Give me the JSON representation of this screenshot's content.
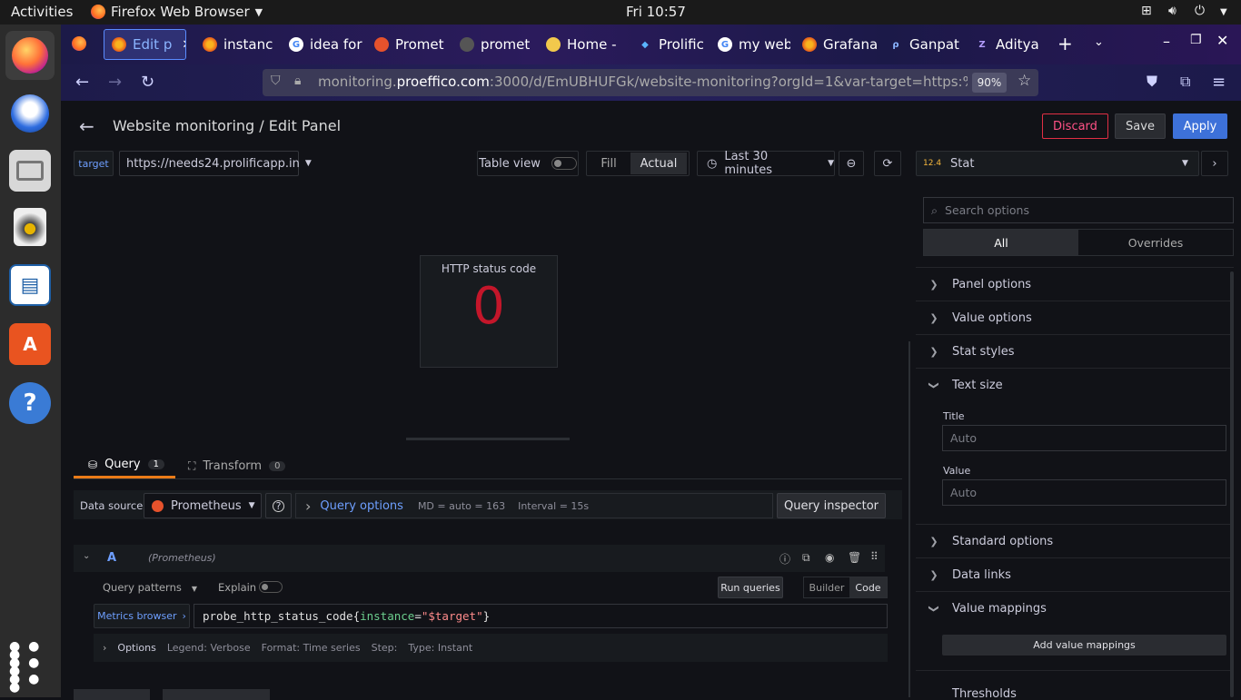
{
  "os": {
    "activities": "Activities",
    "app_menu": "Firefox Web Browser",
    "clock": "Fri 10:57"
  },
  "dock": {
    "apps": [
      "firefox",
      "thunderbird",
      "files",
      "rhythmbox",
      "writer",
      "software",
      "help"
    ]
  },
  "browser": {
    "tabs": [
      {
        "label": "Edit p",
        "icon": "grafana",
        "active": true
      },
      {
        "label": "instanc",
        "icon": "grafana"
      },
      {
        "label": "idea for",
        "icon": "google"
      },
      {
        "label": "Promet",
        "icon": "prometheus"
      },
      {
        "label": "promet",
        "icon": "github"
      },
      {
        "label": "Home -",
        "icon": "home"
      },
      {
        "label": "Prolific",
        "icon": "prolific"
      },
      {
        "label": "my web",
        "icon": "google"
      },
      {
        "label": "Grafana",
        "icon": "grafana"
      },
      {
        "label": "Ganpat",
        "icon": "ganpat"
      },
      {
        "label": "Aditya",
        "icon": "aditya"
      }
    ],
    "url_prefix": "monitoring.",
    "url_domain": "proeffico.com",
    "url_rest": ":3000/d/EmUBHUFGk/website-monitoring?orgId=1&var-target=https:%2F%",
    "zoom": "90%"
  },
  "grafana": {
    "title": "Website monitoring / Edit Panel",
    "discard": "Discard",
    "save": "Save",
    "apply": "Apply",
    "var_label": "target",
    "var_value": "https://needs24.prolificapp.in",
    "table_view": "Table view",
    "fill": "Fill",
    "actual": "Actual",
    "time_range": "Last 30 minutes",
    "viz_type": "Stat",
    "stat": {
      "title": "HTTP status code",
      "value": "0"
    },
    "tabs": {
      "query": "Query",
      "query_count": "1",
      "transform": "Transform",
      "transform_count": "0"
    },
    "datasource_label": "Data source",
    "datasource": "Prometheus",
    "query_options": "Query options",
    "md": "MD = auto = 163",
    "interval": "Interval = 15s",
    "query_inspector": "Query inspector",
    "query": {
      "ref": "A",
      "ds": "(Prometheus)",
      "patterns": "Query patterns",
      "explain": "Explain",
      "run": "Run queries",
      "builder": "Builder",
      "code": "Code",
      "metrics_browser": "Metrics browser",
      "expr_metric": "probe_http_status_code",
      "expr_label": "instance",
      "expr_value": "\"$target\"",
      "options": "Options",
      "legend": "Legend: Verbose",
      "format": "Format: Time series",
      "step": "Step:",
      "type": "Type: Instant"
    },
    "options_pane": {
      "search_placeholder": "Search options",
      "all": "All",
      "overrides": "Overrides",
      "sections": [
        "Panel options",
        "Value options",
        "Stat styles"
      ],
      "text_size": "Text size",
      "title_label": "Title",
      "title_value": "Auto",
      "value_label": "Value",
      "value_value": "Auto",
      "sections2": [
        "Standard options",
        "Data links"
      ],
      "value_mappings": "Value mappings",
      "add_mappings": "Add value mappings",
      "thresholds": "Thresholds"
    }
  },
  "colors": {
    "accent": "#3d71d9",
    "discard": "#e02f44",
    "stat_value": "#c4162a",
    "blue_text": "#6e9fff"
  }
}
